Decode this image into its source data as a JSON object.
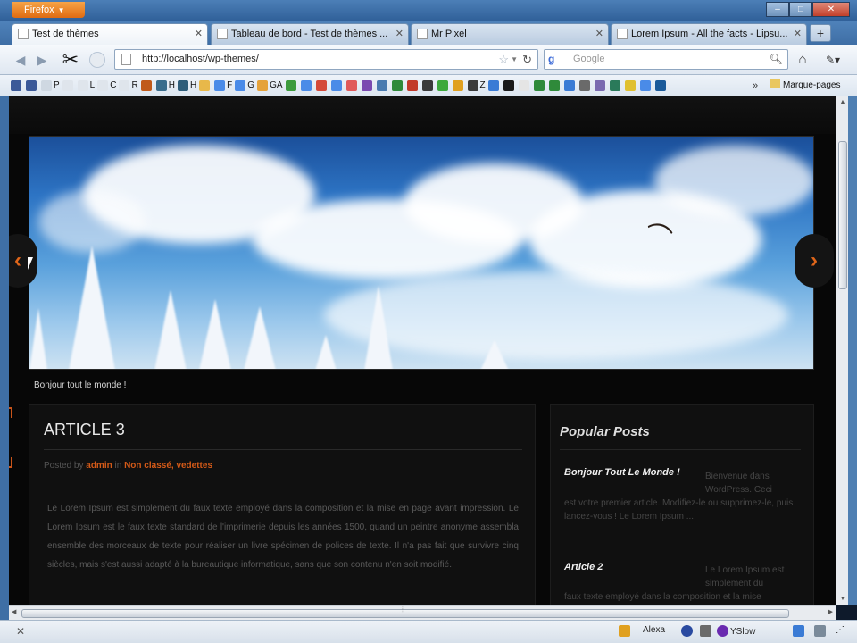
{
  "browser": {
    "menu_label": "Firefox",
    "window_controls": [
      "–",
      "□",
      "✕"
    ]
  },
  "tabs": [
    {
      "label": "Test de thèmes",
      "active": true
    },
    {
      "label": "Tableau de bord - Test de thèmes ...",
      "active": false
    },
    {
      "label": "Mr Pixel",
      "active": false
    },
    {
      "label": "Lorem Ipsum - All the facts - Lipsu...",
      "active": false
    }
  ],
  "new_tab_label": "+",
  "nav": {
    "url": "http://localhost/wp-themes/",
    "search_placeholder": "Google",
    "search_engine_letter": "g"
  },
  "bookmarks": {
    "items": [
      {
        "label": "",
        "color": "#3b5998"
      },
      {
        "label": "",
        "color": "#3b5998"
      },
      {
        "label": "P",
        "color": "#cfd8e2"
      },
      {
        "label": "",
        "color": "#dfe5ec"
      },
      {
        "label": "L",
        "color": "#dfe5ec"
      },
      {
        "label": "C",
        "color": "#dfe5ec"
      },
      {
        "label": "R",
        "color": "#dfe5ec"
      },
      {
        "label": "",
        "color": "#c05a1a"
      },
      {
        "label": "H",
        "color": "#3a6d8c"
      },
      {
        "label": "H",
        "color": "#2d5d7a"
      },
      {
        "label": "",
        "color": "#e8b84a"
      },
      {
        "label": "F",
        "color": "#4a8be8"
      },
      {
        "label": "G",
        "color": "#4a8be8"
      },
      {
        "label": "GA",
        "color": "#e5a23a"
      },
      {
        "label": "",
        "color": "#3d9b3d"
      },
      {
        "label": "",
        "color": "#4a8be8"
      },
      {
        "label": "",
        "color": "#d44a3a"
      },
      {
        "label": "",
        "color": "#4a8be8"
      },
      {
        "label": "",
        "color": "#e05a5a"
      },
      {
        "label": "",
        "color": "#7a4ab0"
      },
      {
        "label": "",
        "color": "#4a7bb0"
      },
      {
        "label": "",
        "color": "#2f8a3a"
      },
      {
        "label": "",
        "color": "#c23a2a"
      },
      {
        "label": "",
        "color": "#3a3a3a"
      },
      {
        "label": "",
        "color": "#3da93d"
      },
      {
        "label": "",
        "color": "#e0a020"
      },
      {
        "label": "Z",
        "color": "#3a3a3a"
      },
      {
        "label": "",
        "color": "#3a7bd5"
      },
      {
        "label": "",
        "color": "#1a1a1a"
      },
      {
        "label": "",
        "color": "#e5e5e5"
      },
      {
        "label": "",
        "color": "#2f8a3a"
      },
      {
        "label": "",
        "color": "#2f8a3a"
      },
      {
        "label": "",
        "color": "#3a7bd5"
      },
      {
        "label": "",
        "color": "#6a6a6a"
      },
      {
        "label": "",
        "color": "#7a6ab0"
      },
      {
        "label": "",
        "color": "#2a7a5a"
      },
      {
        "label": "",
        "color": "#e0c030"
      },
      {
        "label": "",
        "color": "#4a8be8"
      },
      {
        "label": "",
        "color": "#1a5a9a"
      }
    ],
    "more": "»",
    "folder_label": "Marque-pages"
  },
  "page": {
    "slider_caption": "Bonjour tout le monde !",
    "article": {
      "title": "ARTICLE 3",
      "posted_by_prefix": "Posted by",
      "author": "admin",
      "in_word": "in",
      "categories": "Non classé, vedettes",
      "body": "Le Lorem Ipsum est simplement du faux texte employé dans la composition et la mise en page avant impression. Le Lorem Ipsum est le faux texte standard de l'imprimerie depuis les années 1500, quand un peintre anonyme assembla ensemble des morceaux de texte pour réaliser un livre spécimen de polices de texte. Il n'a pas fait que survivre cinq siècles, mais s'est aussi adapté à la bureautique informatique, sans que son contenu n'en soit modifié."
    },
    "sidebar": {
      "title": "Popular Posts",
      "posts": [
        {
          "title": "Bonjour Tout Le Monde !",
          "excerpt_right": "Bienvenue dans WordPress. Ceci",
          "excerpt_rest": "est votre premier article. Modifiez-le ou supprimez-le, puis lancez-vous ! Le Lorem Ipsum ..."
        },
        {
          "title": "Article 2",
          "excerpt_right": "Le Lorem Ipsum est simplement du",
          "excerpt_rest": "faux texte employé dans la composition et la mise"
        }
      ]
    }
  },
  "status": {
    "close_label": "✕",
    "addons": [
      {
        "label": "",
        "color": "#e0a020"
      },
      {
        "label": "Alexa",
        "color": "#1a1a1a"
      },
      {
        "label": "",
        "color": "#2a4aa0"
      },
      {
        "label": "",
        "color": "#6a6a6a"
      },
      {
        "label": "YSlow",
        "color": "#6a2ab0"
      }
    ]
  },
  "colors": {
    "accent_orange": "#d45a18",
    "page_bg": "#070707"
  }
}
